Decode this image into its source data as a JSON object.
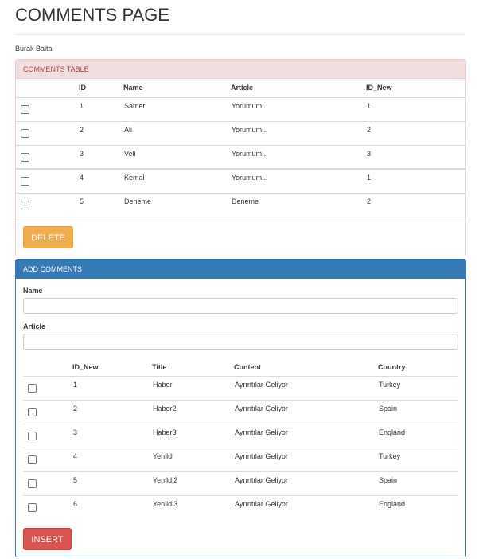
{
  "page": {
    "title": "COMMENTS PAGE",
    "author": "Burak Balta"
  },
  "comments_panel": {
    "heading": "COMMENTS TABLE",
    "columns": [
      "",
      "ID",
      "Name",
      "Article",
      "ID_New"
    ],
    "rows": [
      {
        "id": "1",
        "name": "Samet",
        "article": "Yorumum...",
        "id_new": "1"
      },
      {
        "id": "2",
        "name": "Ali",
        "article": "Yorumum...",
        "id_new": "2"
      },
      {
        "id": "3",
        "name": "Veli",
        "article": "Yorumum...",
        "id_new": "3"
      },
      {
        "id": "4",
        "name": "Kemal",
        "article": "Yorumum...",
        "id_new": "1"
      },
      {
        "id": "5",
        "name": "Deneme",
        "article": "Deneme",
        "id_new": "2"
      }
    ],
    "delete_label": "DELETE"
  },
  "add_panel": {
    "heading": "ADD COMMENTS",
    "name_label": "Name",
    "name_value": "",
    "article_label": "Article",
    "article_value": "",
    "columns": [
      "",
      "ID_New",
      "Title",
      "Content",
      "Country"
    ],
    "rows": [
      {
        "id_new": "1",
        "title": "Haber",
        "content": "Ayrıntılar Geliyor",
        "country": "Turkey"
      },
      {
        "id_new": "2",
        "title": "Haber2",
        "content": "Ayrıntılar Geliyor",
        "country": "Spain"
      },
      {
        "id_new": "3",
        "title": "Haber3",
        "content": "Ayrıntılar Geliyor",
        "country": "England"
      },
      {
        "id_new": "4",
        "title": "Yenildi",
        "content": "Ayrıntılar Geliyor",
        "country": "Turkey"
      },
      {
        "id_new": "5",
        "title": "Yenildi2",
        "content": "Ayrıntılar Geliyor",
        "country": "Spain"
      },
      {
        "id_new": "6",
        "title": "Yenildi3",
        "content": "Ayrıntılar Geliyor",
        "country": "England"
      }
    ],
    "insert_label": "INSERT"
  },
  "colors": {
    "danger_heading_bg": "#f2dede",
    "danger_heading_text": "#a94442",
    "primary": "#337ab7",
    "warning_button": "#f0ad4e",
    "danger_button": "#d9534f"
  }
}
